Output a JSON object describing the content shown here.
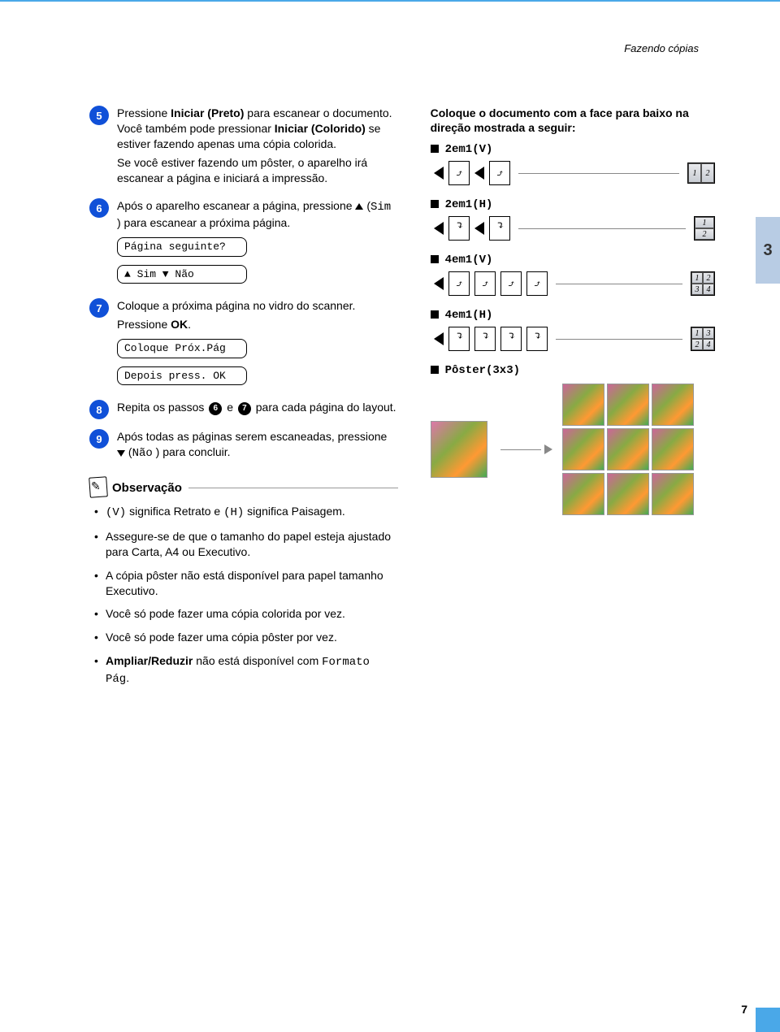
{
  "header": {
    "title": "Fazendo cópias"
  },
  "sidetab": {
    "chapter": "3"
  },
  "page_number": "7",
  "steps": {
    "s5": {
      "num": "5",
      "text_a": "Pressione ",
      "bold_a": "Iniciar (Preto)",
      "text_b": " para escanear o documento. Você também pode pressionar ",
      "bold_b": "Iniciar (Colorido)",
      "text_c": " se estiver fazendo apenas uma cópia colorida.",
      "text_d": "Se você estiver fazendo um pôster, o aparelho irá escanear a página e iniciará a impressão."
    },
    "s6": {
      "num": "6",
      "text_a": "Após o aparelho escanear a página, pressione ",
      "sym": "▲",
      "mono_a": "Sim",
      "text_b": ") para escanear a próxima página.",
      "lcd1": "Página seguinte?",
      "lcd2": "▲ Sim ▼ Não"
    },
    "s7": {
      "num": "7",
      "text_a": "Coloque a próxima página no vidro do scanner.",
      "text_b": "Pressione ",
      "bold_b": "OK",
      "text_c": ".",
      "lcd1": "Coloque Próx.Pág",
      "lcd2": "Depois press. OK"
    },
    "s8": {
      "num": "8",
      "text_a": "Repita os passos ",
      "ref1": "6",
      "mid": " e ",
      "ref2": "7",
      "text_b": " para cada página do layout."
    },
    "s9": {
      "num": "9",
      "text_a": "Após todas as páginas serem escaneadas, pressione ",
      "sym": "▼",
      "mono_a": "Não",
      "text_b": ") para concluir."
    }
  },
  "note": {
    "title": "Observação",
    "items": [
      {
        "pre": "(V)",
        "mid": " significa Retrato e ",
        "pre2": "(H)",
        "post": " significa Paisagem."
      },
      {
        "text": "Assegure-se de que o tamanho do papel esteja ajustado para Carta, A4 ou Executivo."
      },
      {
        "text": "A cópia pôster não está disponível para papel tamanho Executivo."
      },
      {
        "text": "Você só pode fazer uma cópia colorida por vez."
      },
      {
        "text": "Você só pode fazer uma cópia pôster por vez."
      },
      {
        "bold": "Ampliar/Reduzir",
        "mid": " não está disponível com ",
        "mono": "Formato Pág",
        "post": "."
      }
    ]
  },
  "right": {
    "heading": "Coloque o documento com a face para baixo na direção mostrada a seguir:",
    "opts": {
      "a": "2em1(V)",
      "b": "2em1(H)",
      "c": "4em1(V)",
      "d": "4em1(H)",
      "e": "Pôster(3x3)"
    },
    "nums": {
      "n1": "1",
      "n2": "2",
      "n3": "3",
      "n4": "4"
    }
  }
}
